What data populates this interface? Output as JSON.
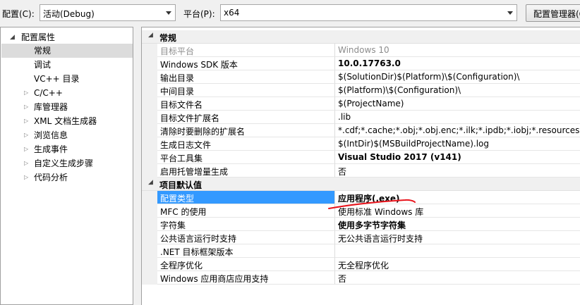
{
  "toolbar": {
    "config_label": "配置(C):",
    "config_value": "活动(Debug)",
    "platform_label": "平台(P):",
    "platform_value": "x64",
    "manager_button": "配置管理器(O)"
  },
  "tree": {
    "root": "配置属性",
    "items": [
      "常规",
      "调试",
      "VC++ 目录",
      "C/C++",
      "库管理器",
      "XML 文档生成器",
      "浏览信息",
      "生成事件",
      "自定义生成步骤",
      "代码分析"
    ],
    "selected": "常规"
  },
  "sections": [
    {
      "title": "常规",
      "rows": [
        {
          "name": "目标平台",
          "value": "Windows 10",
          "dim": true
        },
        {
          "name": "Windows SDK 版本",
          "value": "10.0.17763.0",
          "bold": true
        },
        {
          "name": "输出目录",
          "value": "$(SolutionDir)$(Platform)\\$(Configuration)\\"
        },
        {
          "name": "中间目录",
          "value": "$(Platform)\\$(Configuration)\\"
        },
        {
          "name": "目标文件名",
          "value": "$(ProjectName)"
        },
        {
          "name": "目标文件扩展名",
          "value": ".lib"
        },
        {
          "name": "清除时要删除的扩展名",
          "value": "*.cdf;*.cache;*.obj;*.obj.enc;*.ilk;*.ipdb;*.iobj;*.resources;*.tlb;"
        },
        {
          "name": "生成日志文件",
          "value": "$(IntDir)$(MSBuildProjectName).log"
        },
        {
          "name": "平台工具集",
          "value": "Visual Studio 2017 (v141)",
          "bold": true
        },
        {
          "name": "启用托管增量生成",
          "value": "否"
        }
      ]
    },
    {
      "title": "项目默认值",
      "rows": [
        {
          "name": "配置类型",
          "value": "应用程序(.exe)",
          "bold": true,
          "selected": true
        },
        {
          "name": "MFC 的使用",
          "value": "使用标准 Windows 库"
        },
        {
          "name": "字符集",
          "value": "使用多字节字符集",
          "bold": true
        },
        {
          "name": "公共语言运行时支持",
          "value": "无公共语言运行时支持"
        },
        {
          "name": ".NET 目标框架版本",
          "value": ""
        },
        {
          "name": "全程序优化",
          "value": "无全程序优化"
        },
        {
          "name": "Windows 应用商店应用支持",
          "value": "否"
        }
      ]
    }
  ],
  "colors": {
    "selection": "#3399ff",
    "annotation": "#e8141c"
  }
}
